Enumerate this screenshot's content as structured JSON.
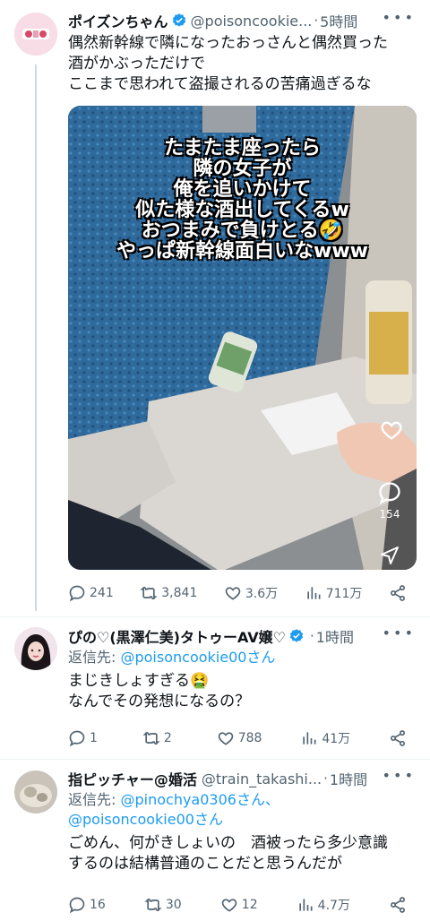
{
  "tweets": [
    {
      "name": "ポイズンちゃん",
      "handle": "@poisoncookie...",
      "time": "5時間",
      "text_lines": [
        "偶然新幹線で隣になったおっさんと偶然買った",
        "酒がかぶっただけで",
        "ここまで思われて盗撮されるの苦痛過ぎるな"
      ],
      "media": {
        "caption_lines": [
          "たまたま座ったら",
          "隣の女子が",
          "俺を追いかけて",
          "似た様な酒出してくるw",
          "おつまみで負けとる🤣",
          "やっぱ新幹線面白いなwww"
        ],
        "reply_count": "154"
      },
      "stats": {
        "replies": "241",
        "retweets": "3,841",
        "likes": "3.6万",
        "views": "711万"
      }
    },
    {
      "name": "ぴの♡(黒澤仁美)タトゥーAV嬢♡",
      "handle": "",
      "time": "1時間",
      "replying_label": "返信先: ",
      "replying_to": "@poisoncookie00さん",
      "text_lines": [
        "まじきしょすぎる🤮",
        "なんでその発想になるの？"
      ],
      "stats": {
        "replies": "1",
        "retweets": "2",
        "likes": "788",
        "views": "41万"
      }
    },
    {
      "name": "指ピッチャー@婚活",
      "handle": "@train_takashi...",
      "time": "1時間",
      "replying_label": "返信先: ",
      "replying_to_1": "@pinochya0306さん、",
      "replying_to_2": "@poisoncookie00さん",
      "text_lines": [
        "ごめん、何がきしょいの　酒被ったら多少意識",
        "するのは結構普通のことだと思うんだが"
      ],
      "stats": {
        "replies": "16",
        "retweets": "30",
        "likes": "12",
        "views": "4.7万"
      }
    }
  ],
  "colors": {
    "accent": "#1d9bf0",
    "secondary_text": "#536471",
    "divider": "#eff3f4"
  }
}
